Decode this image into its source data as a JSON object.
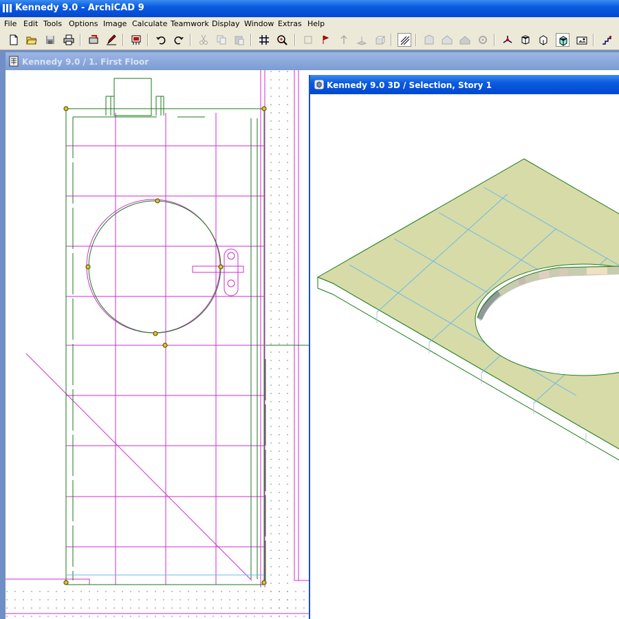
{
  "app": {
    "title": "Kennedy 9.0 - ArchiCAD 9"
  },
  "menu": [
    "File",
    "Edit",
    "Tools",
    "Options",
    "Image",
    "Calculate",
    "Teamwork",
    "Display",
    "Window",
    "Extras",
    "Help"
  ],
  "toolbar": {
    "buttons": [
      "new-file-icon",
      "open-folder-icon",
      "save-icon",
      "print-icon",
      "plot-icon",
      "pen-icon",
      "layers-icon",
      "undo-icon",
      "redo-icon",
      "cut-icon",
      "copy-icon",
      "paste-icon",
      "grid-icon",
      "magic-wand-icon",
      "floor-plan-icon",
      "elevation-icon",
      "section-icon",
      "3d-axon-icon",
      "3d-persp-icon",
      "3d-window-icon",
      "render-icon",
      "photo-icon",
      "stairs-icon"
    ],
    "pressed": [
      "3d-window-icon"
    ]
  },
  "floor_window": {
    "title": "Kennedy 9.0 / 1. First Floor"
  },
  "window_3d": {
    "title": "Kennedy 9.0 3D / Selection, Story 1"
  },
  "colors": {
    "title_blue": "#0b5be0",
    "inactive_title": "#7b9bd3",
    "menu_bg": "#ece9d8",
    "wall_green": "#1a7a1a",
    "grid_magenta": "#d02bd0",
    "slab_fill": "#d7dba8",
    "grid_cyan": "#6ab8e8"
  }
}
